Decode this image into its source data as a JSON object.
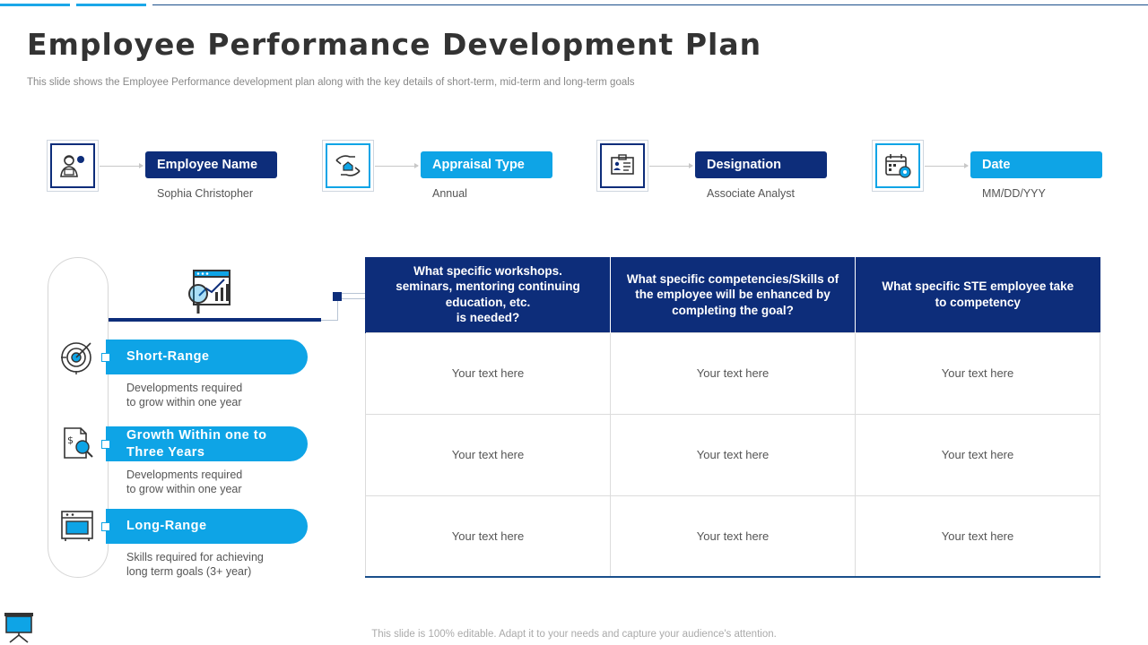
{
  "title": "Employee Performance Development Plan",
  "subtitle": "This slide shows the Employee Performance development plan along with the key  details of short-term, mid-term and long-term goals",
  "info_items": [
    {
      "label": "Employee Name",
      "value": "Sophia Christopher",
      "icon": "employee-icon",
      "style": "navy"
    },
    {
      "label": "Appraisal Type",
      "value": "Annual",
      "icon": "hand-care-icon",
      "style": "cyan"
    },
    {
      "label": "Designation",
      "value": "Associate Analyst",
      "icon": "id-card-icon",
      "style": "navy"
    },
    {
      "label": "Date",
      "value": "MM/DD/YYY",
      "icon": "calendar-gear-icon",
      "style": "cyan"
    }
  ],
  "header_icon": "growth-chart-magnifier-icon",
  "ranges": [
    {
      "label": "Short-Range",
      "desc_line1": "Developments  required",
      "desc_line2": "to grow within one year",
      "icon": "target-icon"
    },
    {
      "label_line1": "Growth Within one to",
      "label_line2": "Three Years",
      "desc_line1": "Developments  required",
      "desc_line2": "to grow within one year",
      "icon": "finance-document-icon"
    },
    {
      "label": "Long-Range",
      "desc_line1": "Skills required  for achieving",
      "desc_line2": "long term goals (3+ year)",
      "icon": "oven-icon"
    }
  ],
  "table": {
    "headers": [
      {
        "line1": "What specific workshops.",
        "line2": "seminars, mentoring continuing",
        "line3": "education, etc.",
        "line4": "is needed?"
      },
      {
        "line1": "What specific competencies/Skills of",
        "line2": "the employee will be enhanced by",
        "line3": "completing the goal?"
      },
      {
        "line1": "What specific STE employee take",
        "line2": "to competency"
      }
    ],
    "rows": [
      [
        "Your text here",
        "Your text here",
        "Your text here"
      ],
      [
        "Your text here",
        "Your text here",
        "Your text here"
      ],
      [
        "Your text here",
        "Your text here",
        "Your text here"
      ]
    ]
  },
  "footer": "This slide is 100% editable. Adapt it to your needs and capture your audience's attention.",
  "corner_icon": "presentation-board-icon",
  "colors": {
    "navy": "#0d2d7a",
    "cyan": "#0ea4e6"
  }
}
